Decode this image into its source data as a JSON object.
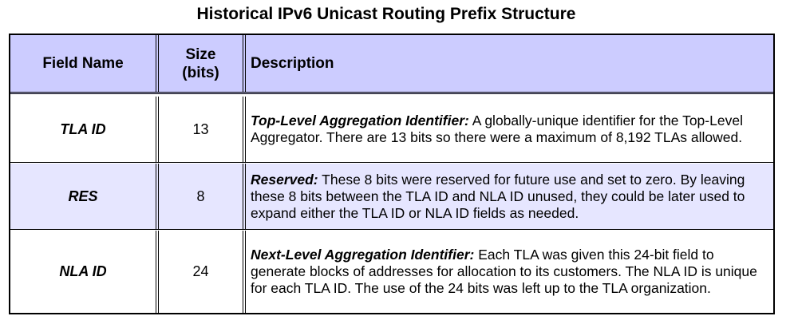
{
  "title": "Historical IPv6 Unicast Routing Prefix Structure",
  "table": {
    "headers": {
      "field_name": "Field Name",
      "size_line1": "Size",
      "size_line2": "(bits)",
      "description": "Description"
    },
    "rows": [
      {
        "field": "TLA ID",
        "size": "13",
        "term": "Top-Level Aggregation Identifier:",
        "description": " A globally-unique identifier for the Top-Level Aggregator. There are 13 bits so there were a maximum of 8,192 TLAs allowed."
      },
      {
        "field": "RES",
        "size": "8",
        "term": "Reserved:",
        "description": " These 8 bits were reserved for future use and set to zero. By leaving these 8 bits between the TLA ID and NLA ID unused, they could be later used to expand either the TLA ID or NLA ID fields as needed."
      },
      {
        "field": "NLA ID",
        "size": "24",
        "term": "Next-Level Aggregation Identifier:",
        "description": " Each TLA was given this 24-bit field to generate blocks of addresses for allocation to its customers. The NLA ID is unique for each TLA ID. The use of the 24 bits was left up to the TLA organization."
      }
    ]
  },
  "colors": {
    "header_bg": "#ccccff",
    "alt_row_bg": "#e6e6ff",
    "border": "#000000"
  }
}
